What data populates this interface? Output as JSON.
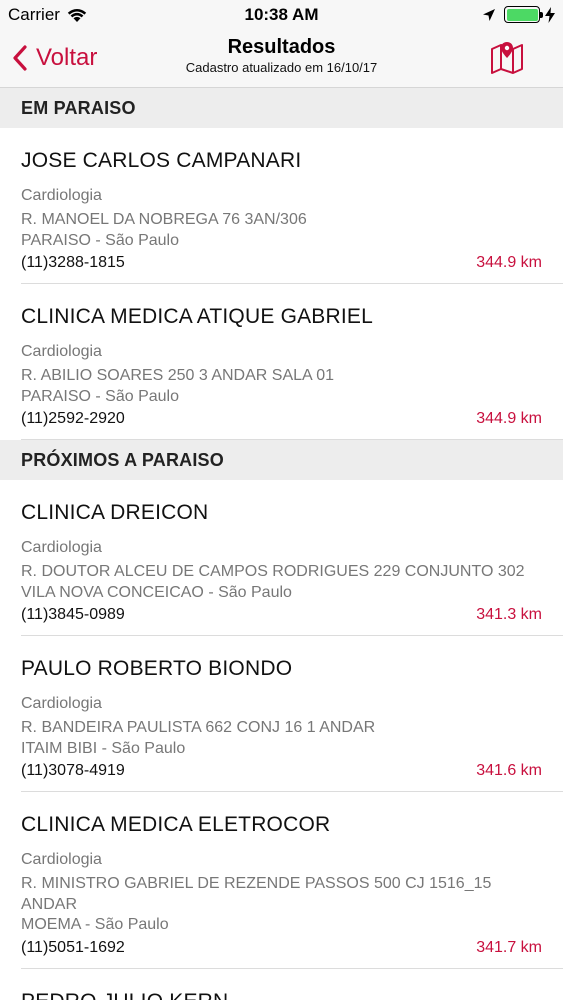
{
  "status": {
    "carrier": "Carrier",
    "time": "10:38 AM"
  },
  "nav": {
    "back_label": "Voltar",
    "title": "Resultados",
    "subtitle": "Cadastro atualizado em 16/10/17",
    "map_icon": "map-pin-icon"
  },
  "colors": {
    "accent": "#c8103e",
    "section_bg": "#ededed",
    "battery": "#4cd964"
  },
  "sections": [
    {
      "title": "EM PARAISO",
      "items": [
        {
          "name": "JOSE CARLOS CAMPANARI",
          "specialty": "Cardiologia",
          "address": "R. MANOEL DA NOBREGA 76 3AN/306",
          "city": "PARAISO - São Paulo",
          "phone": "(11)3288-1815",
          "distance": "344.9 km"
        },
        {
          "name": "CLINICA MEDICA ATIQUE GABRIEL",
          "specialty": "Cardiologia",
          "address": "R. ABILIO SOARES 250 3 ANDAR SALA 01",
          "city": "PARAISO - São Paulo",
          "phone": "(11)2592-2920",
          "distance": "344.9 km"
        }
      ]
    },
    {
      "title": "PRÓXIMOS A PARAISO",
      "items": [
        {
          "name": "CLINICA DREICON",
          "specialty": "Cardiologia",
          "address": "R. DOUTOR ALCEU DE CAMPOS RODRIGUES 229 CONJUNTO 302",
          "city": "VILA NOVA CONCEICAO - São Paulo",
          "phone": "(11)3845-0989",
          "distance": "341.3 km"
        },
        {
          "name": "PAULO ROBERTO BIONDO",
          "specialty": "Cardiologia",
          "address": "R. BANDEIRA PAULISTA 662 CONJ 16 1 ANDAR",
          "city": "ITAIM BIBI - São Paulo",
          "phone": "(11)3078-4919",
          "distance": "341.6 km"
        },
        {
          "name": "CLINICA MEDICA ELETROCOR",
          "specialty": "Cardiologia",
          "address": "R. MINISTRO GABRIEL DE REZENDE PASSOS 500 CJ 1516_15 ANDAR",
          "city": "MOEMA - São Paulo",
          "phone": "(11)5051-1692",
          "distance": "341.7 km"
        },
        {
          "name": "PEDRO JULIO KERN",
          "specialty": "",
          "address": "",
          "city": "",
          "phone": "",
          "distance": ""
        }
      ]
    }
  ]
}
